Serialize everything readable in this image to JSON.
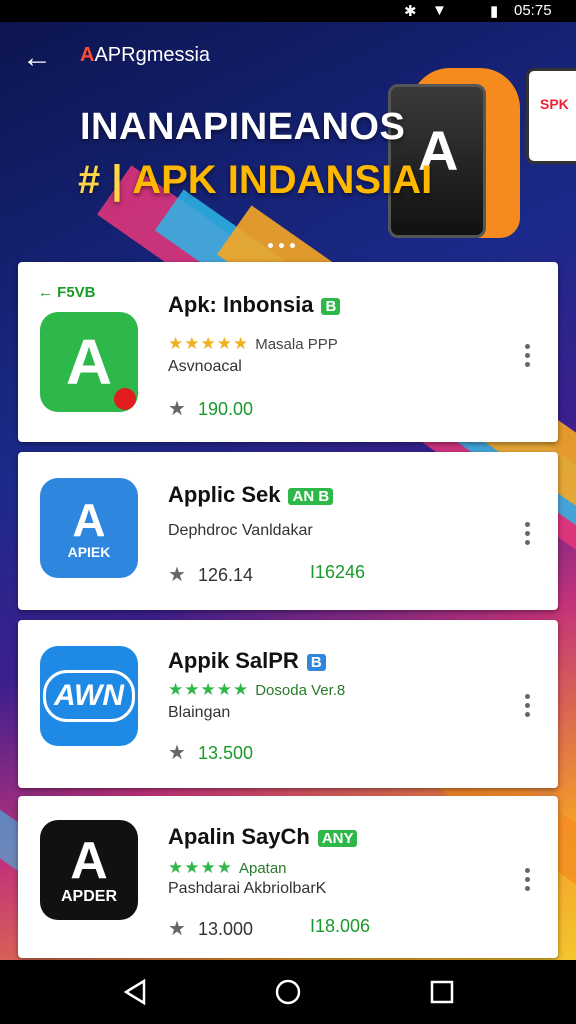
{
  "status_bar": {
    "time": "05:75"
  },
  "header": {
    "logo_mark": "A",
    "logo_text": "APRgmessia",
    "hero_title": "INANAPINEANOS",
    "hero_prefix": "# |",
    "hero_subtitle": "APK INDANSIAI",
    "phone_text": "SPK"
  },
  "apps": [
    {
      "badge": "← F5VB",
      "name": "Apk: Inbonsia",
      "tag": "B",
      "stars": "★★★★★",
      "stars_label": "Masala PPP",
      "developer": "Asvnoacal",
      "rating": "190.00",
      "extra": "",
      "icon_color": "#2fb84a",
      "icon_glyph": "A",
      "icon_caption": ""
    },
    {
      "badge": "",
      "name": "Applic Sek",
      "tag": "AN B",
      "stars": "",
      "stars_label": "",
      "developer": "Dephdroc Vanldakar",
      "rating": "126.14",
      "extra": "I16246",
      "icon_color": "#2e86de",
      "icon_glyph": "A",
      "icon_caption": "APIEK"
    },
    {
      "badge": "",
      "name": "Appik SalPR",
      "tag": "B",
      "stars": "★★★★★",
      "stars_label": "Dosoda Ver.8",
      "developer": "Blaingan",
      "rating": "13.500",
      "extra": "",
      "icon_color": "#1f8ae6",
      "icon_glyph": "AWN",
      "icon_caption": ""
    },
    {
      "badge": "",
      "name": "Apalin SayCh",
      "tag": "ANY",
      "stars": "★★★★",
      "stars_label": "Apatan",
      "developer": "Pashdarai",
      "developer2": "AkbriolbarK",
      "rating": "13.000",
      "extra": "I18.006",
      "icon_color": "#111111",
      "icon_glyph": "A",
      "icon_caption": "APDER"
    }
  ],
  "nav": {
    "back": "back-icon",
    "home": "home-icon",
    "recents": "recents-icon"
  }
}
